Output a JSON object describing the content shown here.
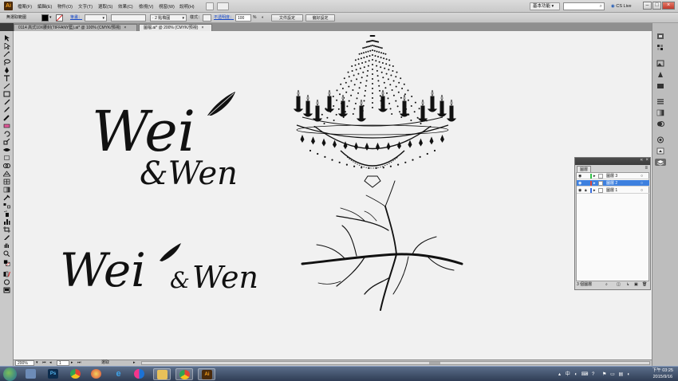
{
  "menubar": {
    "items": [
      "檔案(F)",
      "編輯(E)",
      "物件(O)",
      "文字(T)",
      "選取(S)",
      "效果(C)",
      "檢視(V)",
      "視窗(W)",
      "說明(H)"
    ],
    "essentials": "基本功能",
    "search_placeholder": "",
    "cs_live": "CS Live"
  },
  "control_bar": {
    "selection_label": "無選取範圍",
    "stroke_label": "筆畫：",
    "brush_label": "2 點橢圓",
    "style_label": "樣式：",
    "opacity_label": "不透明度：",
    "opacity_value": "100",
    "opacity_unit": "%",
    "doc_setup_button": "文件設定",
    "prefs_button": "偏好設定"
  },
  "tabs": [
    {
      "label": "0114 高式10X腰封(TIFFANY藍).ai* @ 100% (CMYK/預視)",
      "active": false
    },
    {
      "label": "圖檔.ai* @ 200% (CMYK/預視)",
      "active": true
    }
  ],
  "artwork": {
    "logo_top": {
      "line1": "Wei",
      "line2": "&Wen"
    },
    "logo_bottom": {
      "word1": "Wei",
      "amp": "&",
      "word2": "Wen"
    }
  },
  "layers_panel": {
    "tab_label": "圖層",
    "layers": [
      {
        "name": "圖層 3",
        "color": "#35c34a",
        "selected": false,
        "locked": false
      },
      {
        "name": "圖層 2",
        "color": "#e0463c",
        "selected": true,
        "locked": false
      },
      {
        "name": "圖層 1",
        "color": "#3a6fe0",
        "selected": false,
        "locked": true
      }
    ],
    "footer": "3 個圖層"
  },
  "statusbar": {
    "zoom": "200%",
    "page": "1",
    "mode": "選取"
  },
  "taskbar": {
    "apps": [
      {
        "name": "windows-explorer",
        "label": ""
      },
      {
        "name": "photoshop",
        "label": "Ps"
      },
      {
        "name": "chrome",
        "label": ""
      },
      {
        "name": "paint",
        "label": ""
      },
      {
        "name": "internet-explorer",
        "label": "e"
      },
      {
        "name": "flickr",
        "label": ""
      },
      {
        "name": "folder",
        "label": ""
      },
      {
        "name": "chrome-window",
        "label": ""
      },
      {
        "name": "illustrator",
        "label": "Ai"
      }
    ],
    "ime": "中",
    "time": "下午 03:25",
    "date": "2015/9/16"
  },
  "colors": {
    "accent": "#3d80df",
    "canvas_bg": "#f1f1f1",
    "ai_orange": "#f6a01a"
  }
}
